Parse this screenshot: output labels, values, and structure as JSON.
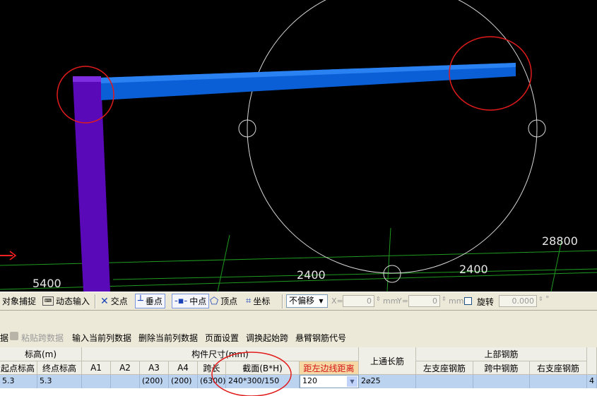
{
  "viewport": {
    "dimension_labels": [
      "5400",
      "2400",
      "2400",
      "28800"
    ]
  },
  "snap_toolbar": {
    "object_snap": "对象捕捉",
    "dynamic_input": "动态输入",
    "intersection": "交点",
    "perpendicular": "垂点",
    "midpoint": "中点",
    "vertex": "顶点",
    "coordinate": "坐标",
    "offset_mode": "不偏移",
    "x_label": "X=",
    "x_value": "0",
    "x_unit": "mm",
    "y_label": "Y=",
    "y_value": "0",
    "y_unit": "mm",
    "rotate_label": "旋转",
    "rotate_value": "0.000",
    "degree": "°"
  },
  "menu": {
    "first_partial": "据",
    "paste_span_data": "粘贴跨数据",
    "input_current_column": "输入当前列数据",
    "delete_current_column": "删除当前列数据",
    "page_setup": "页面设置",
    "swap_start_span": "调换起始跨",
    "cantilever_code": "悬臂钢筋代号"
  },
  "grid": {
    "group_headers": {
      "elevation": "标高(m)",
      "member_size": "构件尺寸(mm)",
      "top_through": "上通长筋",
      "top_rebar": "上部钢筋"
    },
    "columns": {
      "start_elev": "起点标高",
      "end_elev": "终点标高",
      "a1": "A1",
      "a2": "A2",
      "a3": "A3",
      "a4": "A4",
      "span_len": "跨长",
      "section": "截面(B*H)",
      "edge_dist": "距左边线距离",
      "left_support": "左支座钢筋",
      "mid_span": "跨中钢筋",
      "right_support": "右支座钢筋"
    },
    "row": {
      "start_elev": "5.3",
      "end_elev": "5.3",
      "a1": "",
      "a2": "",
      "a3": "(200)",
      "a4": "(200)",
      "span_len": "(6300)",
      "section": "240*300/150",
      "edge_dist": "120",
      "top_through": "2⌀25",
      "left_support": "",
      "mid_span": "",
      "right_support": "",
      "overflow": "4"
    }
  }
}
